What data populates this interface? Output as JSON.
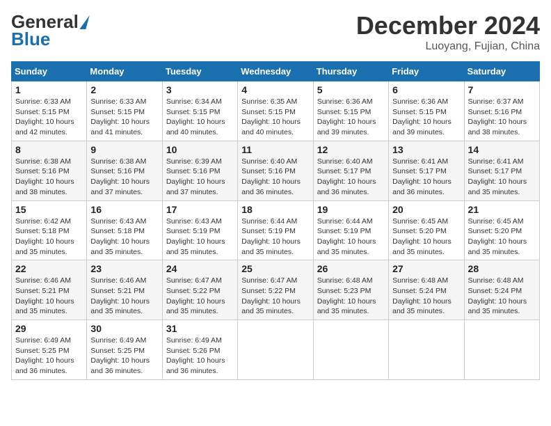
{
  "header": {
    "logo_g": "G",
    "logo_eneral": "eneral",
    "logo_blue": "Blue",
    "month_title": "December 2024",
    "location": "Luoyang, Fujian, China"
  },
  "columns": [
    "Sunday",
    "Monday",
    "Tuesday",
    "Wednesday",
    "Thursday",
    "Friday",
    "Saturday"
  ],
  "weeks": [
    [
      {
        "day": "1",
        "sunrise": "Sunrise: 6:33 AM",
        "sunset": "Sunset: 5:15 PM",
        "daylight": "Daylight: 10 hours and 42 minutes."
      },
      {
        "day": "2",
        "sunrise": "Sunrise: 6:33 AM",
        "sunset": "Sunset: 5:15 PM",
        "daylight": "Daylight: 10 hours and 41 minutes."
      },
      {
        "day": "3",
        "sunrise": "Sunrise: 6:34 AM",
        "sunset": "Sunset: 5:15 PM",
        "daylight": "Daylight: 10 hours and 40 minutes."
      },
      {
        "day": "4",
        "sunrise": "Sunrise: 6:35 AM",
        "sunset": "Sunset: 5:15 PM",
        "daylight": "Daylight: 10 hours and 40 minutes."
      },
      {
        "day": "5",
        "sunrise": "Sunrise: 6:36 AM",
        "sunset": "Sunset: 5:15 PM",
        "daylight": "Daylight: 10 hours and 39 minutes."
      },
      {
        "day": "6",
        "sunrise": "Sunrise: 6:36 AM",
        "sunset": "Sunset: 5:15 PM",
        "daylight": "Daylight: 10 hours and 39 minutes."
      },
      {
        "day": "7",
        "sunrise": "Sunrise: 6:37 AM",
        "sunset": "Sunset: 5:16 PM",
        "daylight": "Daylight: 10 hours and 38 minutes."
      }
    ],
    [
      {
        "day": "8",
        "sunrise": "Sunrise: 6:38 AM",
        "sunset": "Sunset: 5:16 PM",
        "daylight": "Daylight: 10 hours and 38 minutes."
      },
      {
        "day": "9",
        "sunrise": "Sunrise: 6:38 AM",
        "sunset": "Sunset: 5:16 PM",
        "daylight": "Daylight: 10 hours and 37 minutes."
      },
      {
        "day": "10",
        "sunrise": "Sunrise: 6:39 AM",
        "sunset": "Sunset: 5:16 PM",
        "daylight": "Daylight: 10 hours and 37 minutes."
      },
      {
        "day": "11",
        "sunrise": "Sunrise: 6:40 AM",
        "sunset": "Sunset: 5:16 PM",
        "daylight": "Daylight: 10 hours and 36 minutes."
      },
      {
        "day": "12",
        "sunrise": "Sunrise: 6:40 AM",
        "sunset": "Sunset: 5:17 PM",
        "daylight": "Daylight: 10 hours and 36 minutes."
      },
      {
        "day": "13",
        "sunrise": "Sunrise: 6:41 AM",
        "sunset": "Sunset: 5:17 PM",
        "daylight": "Daylight: 10 hours and 36 minutes."
      },
      {
        "day": "14",
        "sunrise": "Sunrise: 6:41 AM",
        "sunset": "Sunset: 5:17 PM",
        "daylight": "Daylight: 10 hours and 35 minutes."
      }
    ],
    [
      {
        "day": "15",
        "sunrise": "Sunrise: 6:42 AM",
        "sunset": "Sunset: 5:18 PM",
        "daylight": "Daylight: 10 hours and 35 minutes."
      },
      {
        "day": "16",
        "sunrise": "Sunrise: 6:43 AM",
        "sunset": "Sunset: 5:18 PM",
        "daylight": "Daylight: 10 hours and 35 minutes."
      },
      {
        "day": "17",
        "sunrise": "Sunrise: 6:43 AM",
        "sunset": "Sunset: 5:19 PM",
        "daylight": "Daylight: 10 hours and 35 minutes."
      },
      {
        "day": "18",
        "sunrise": "Sunrise: 6:44 AM",
        "sunset": "Sunset: 5:19 PM",
        "daylight": "Daylight: 10 hours and 35 minutes."
      },
      {
        "day": "19",
        "sunrise": "Sunrise: 6:44 AM",
        "sunset": "Sunset: 5:19 PM",
        "daylight": "Daylight: 10 hours and 35 minutes."
      },
      {
        "day": "20",
        "sunrise": "Sunrise: 6:45 AM",
        "sunset": "Sunset: 5:20 PM",
        "daylight": "Daylight: 10 hours and 35 minutes."
      },
      {
        "day": "21",
        "sunrise": "Sunrise: 6:45 AM",
        "sunset": "Sunset: 5:20 PM",
        "daylight": "Daylight: 10 hours and 35 minutes."
      }
    ],
    [
      {
        "day": "22",
        "sunrise": "Sunrise: 6:46 AM",
        "sunset": "Sunset: 5:21 PM",
        "daylight": "Daylight: 10 hours and 35 minutes."
      },
      {
        "day": "23",
        "sunrise": "Sunrise: 6:46 AM",
        "sunset": "Sunset: 5:21 PM",
        "daylight": "Daylight: 10 hours and 35 minutes."
      },
      {
        "day": "24",
        "sunrise": "Sunrise: 6:47 AM",
        "sunset": "Sunset: 5:22 PM",
        "daylight": "Daylight: 10 hours and 35 minutes."
      },
      {
        "day": "25",
        "sunrise": "Sunrise: 6:47 AM",
        "sunset": "Sunset: 5:22 PM",
        "daylight": "Daylight: 10 hours and 35 minutes."
      },
      {
        "day": "26",
        "sunrise": "Sunrise: 6:48 AM",
        "sunset": "Sunset: 5:23 PM",
        "daylight": "Daylight: 10 hours and 35 minutes."
      },
      {
        "day": "27",
        "sunrise": "Sunrise: 6:48 AM",
        "sunset": "Sunset: 5:24 PM",
        "daylight": "Daylight: 10 hours and 35 minutes."
      },
      {
        "day": "28",
        "sunrise": "Sunrise: 6:48 AM",
        "sunset": "Sunset: 5:24 PM",
        "daylight": "Daylight: 10 hours and 35 minutes."
      }
    ],
    [
      {
        "day": "29",
        "sunrise": "Sunrise: 6:49 AM",
        "sunset": "Sunset: 5:25 PM",
        "daylight": "Daylight: 10 hours and 36 minutes."
      },
      {
        "day": "30",
        "sunrise": "Sunrise: 6:49 AM",
        "sunset": "Sunset: 5:25 PM",
        "daylight": "Daylight: 10 hours and 36 minutes."
      },
      {
        "day": "31",
        "sunrise": "Sunrise: 6:49 AM",
        "sunset": "Sunset: 5:26 PM",
        "daylight": "Daylight: 10 hours and 36 minutes."
      },
      null,
      null,
      null,
      null
    ]
  ]
}
